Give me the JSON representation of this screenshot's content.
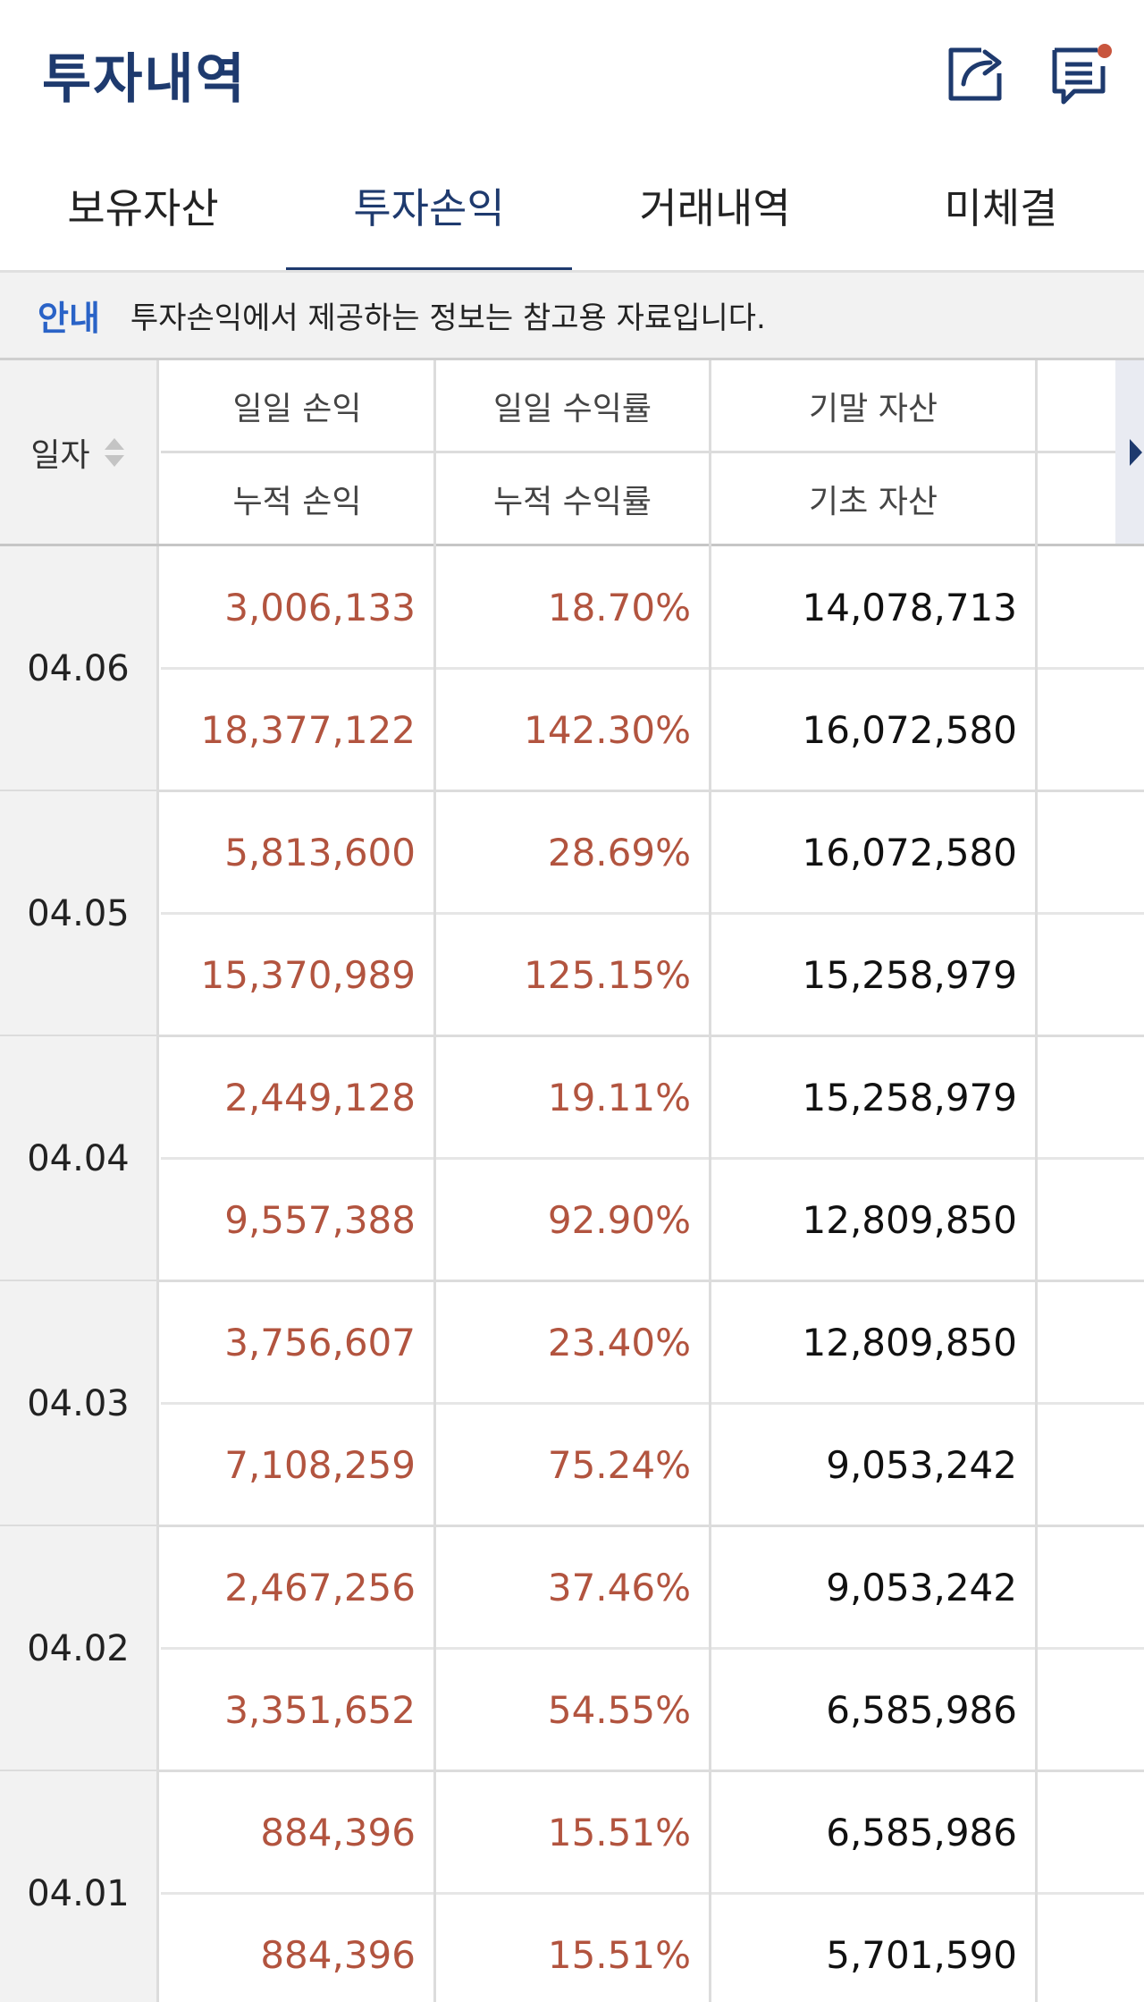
{
  "header": {
    "title": "투자내역",
    "icons": [
      "share-icon",
      "memo-icon"
    ]
  },
  "tabs": [
    {
      "label": "보유자산",
      "active": false
    },
    {
      "label": "투자손익",
      "active": true
    },
    {
      "label": "거래내역",
      "active": false
    },
    {
      "label": "미체결",
      "active": false
    }
  ],
  "notice": {
    "tag": "안내",
    "text": "투자손익에서 제공하는 정보는 참고용 자료입니다."
  },
  "table": {
    "date_header": "일자",
    "col_top": [
      "일일 손익",
      "일일 수익률",
      "기말 자산"
    ],
    "col_bottom": [
      "누적 손익",
      "누적 수익률",
      "기초 자산"
    ],
    "rows": [
      {
        "date": "04.06",
        "daily_pl": "3,006,133",
        "daily_rate": "18.70%",
        "end_asset": "14,078,713",
        "cum_pl": "18,377,122",
        "cum_rate": "142.30%",
        "begin_asset": "16,072,580"
      },
      {
        "date": "04.05",
        "daily_pl": "5,813,600",
        "daily_rate": "28.69%",
        "end_asset": "16,072,580",
        "cum_pl": "15,370,989",
        "cum_rate": "125.15%",
        "begin_asset": "15,258,979"
      },
      {
        "date": "04.04",
        "daily_pl": "2,449,128",
        "daily_rate": "19.11%",
        "end_asset": "15,258,979",
        "cum_pl": "9,557,388",
        "cum_rate": "92.90%",
        "begin_asset": "12,809,850"
      },
      {
        "date": "04.03",
        "daily_pl": "3,756,607",
        "daily_rate": "23.40%",
        "end_asset": "12,809,850",
        "cum_pl": "7,108,259",
        "cum_rate": "75.24%",
        "begin_asset": "9,053,242"
      },
      {
        "date": "04.02",
        "daily_pl": "2,467,256",
        "daily_rate": "37.46%",
        "end_asset": "9,053,242",
        "cum_pl": "3,351,652",
        "cum_rate": "54.55%",
        "begin_asset": "6,585,986"
      },
      {
        "date": "04.01",
        "daily_pl": "884,396",
        "daily_rate": "15.51%",
        "end_asset": "6,585,986",
        "cum_pl": "884,396",
        "cum_rate": "15.51%",
        "begin_asset": "5,701,590"
      }
    ]
  },
  "colors": {
    "brand": "#1e3a6e",
    "notice_tag": "#2a63c7",
    "profit": "#b2543f",
    "notification_dot": "#c8553d"
  }
}
